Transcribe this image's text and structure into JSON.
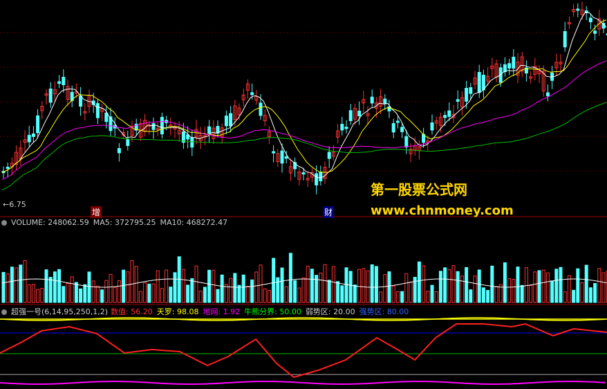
{
  "price_panel": {
    "low_label": "6.75",
    "marker_left": "增",
    "marker_right": "财"
  },
  "volume_panel": {
    "title": "VOLUME: 248062.59",
    "ma5": "MA5: 372795.25",
    "ma10": "MA10: 468272.47"
  },
  "indicator_panel": {
    "name": "超强一号(6,14,95,250,1,2)",
    "value": "数值: 56.20",
    "sky": "天罗: 98.08",
    "earth": "地网: 1.92",
    "bull_bear": "牛熊分界: 50.00",
    "weak": "弱势区: 20.00",
    "strong": "强势区: 80.00"
  },
  "watermark": {
    "title": "第一股票公式网",
    "url": "www.chnmoney.com"
  },
  "colors": {
    "up": "#ff3232",
    "down": "#54ffff",
    "ma_white": "#ffffff",
    "ma_yellow": "#ffff00",
    "ma_magenta": "#ff00ff",
    "ma_green": "#00c000",
    "signal_red": "#ff2020",
    "weak_line": "#00c000",
    "strong_line": "#0000ff"
  }
}
